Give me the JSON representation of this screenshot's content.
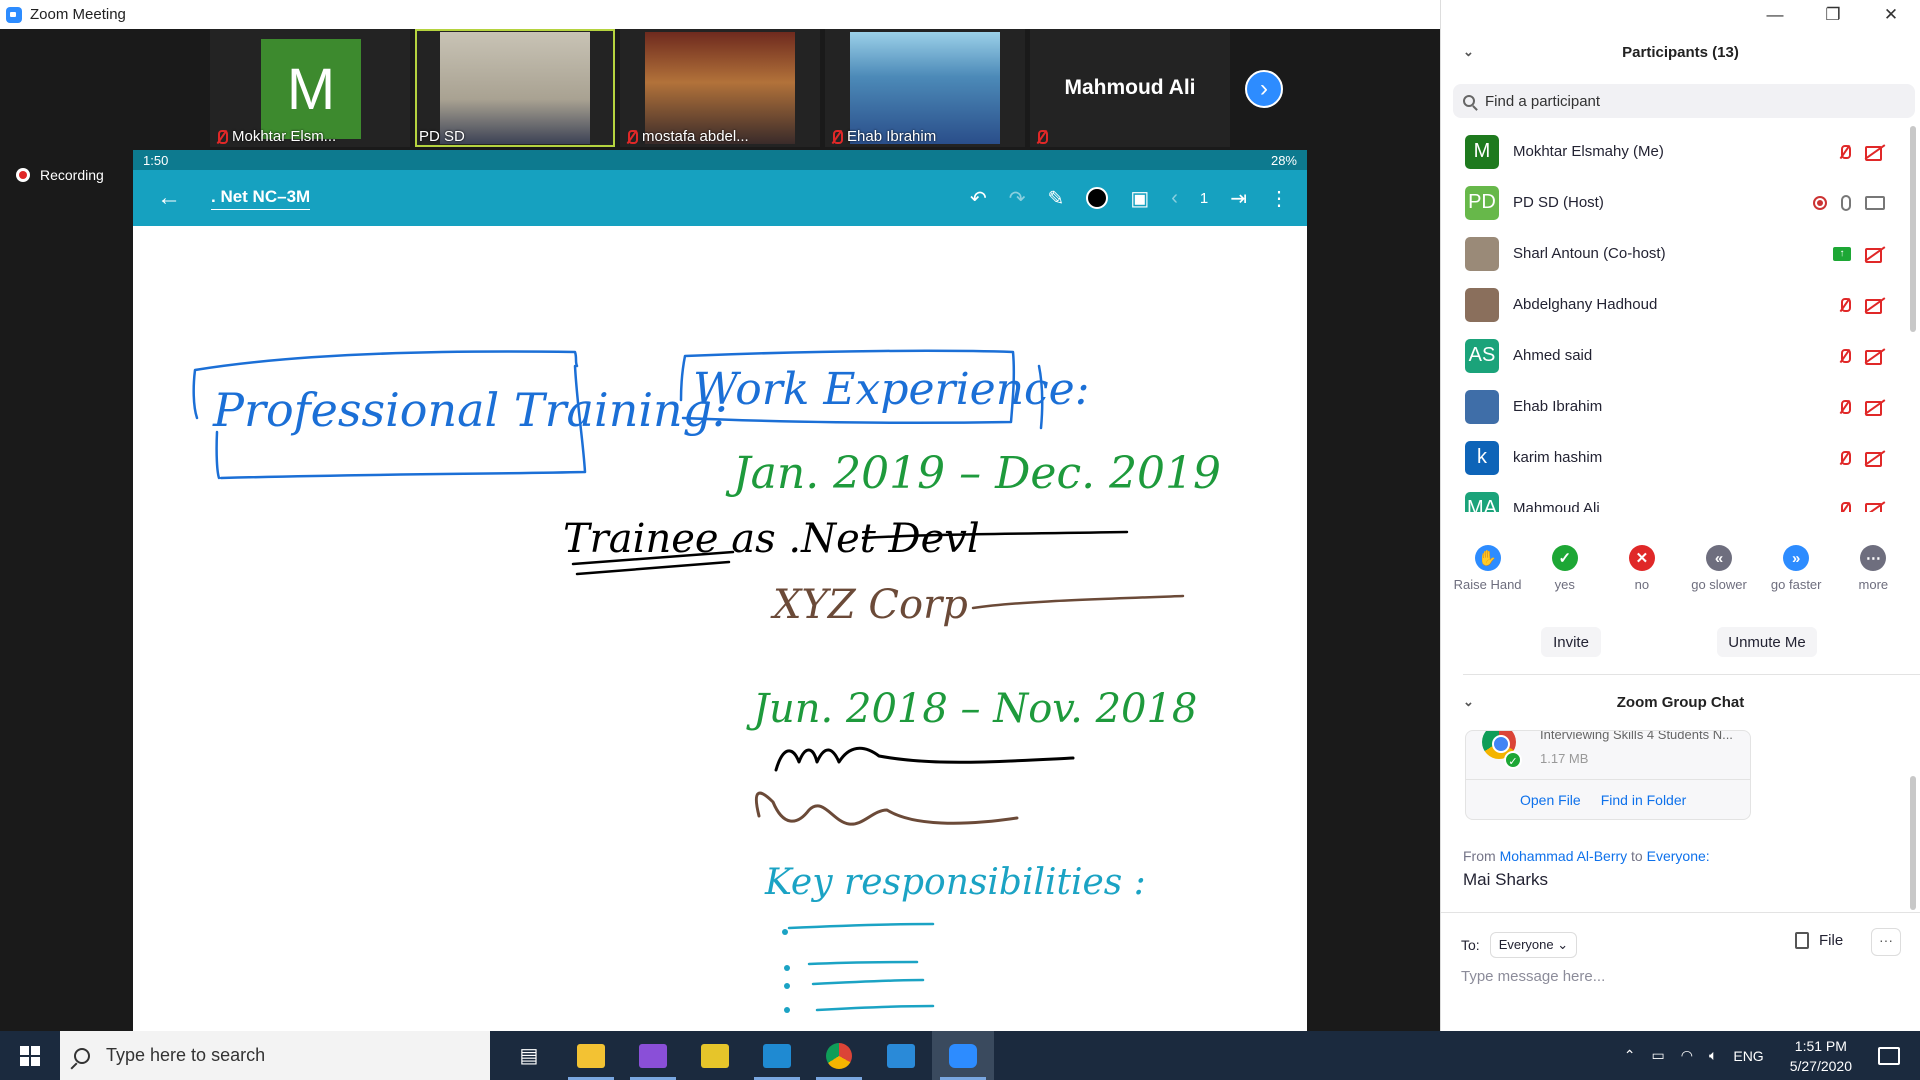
{
  "window": {
    "title": "Zoom Meeting"
  },
  "gallery": {
    "tiles": [
      {
        "name": "Mokhtar Elsm...",
        "avatar_letter": "M",
        "muted": true
      },
      {
        "name": "PD SD",
        "muted": false,
        "active": true
      },
      {
        "name": "mostafa abdel...",
        "muted": true
      },
      {
        "name": "Ehab Ibrahim",
        "muted": true
      },
      {
        "name": "",
        "big_name": "Mahmoud Ali",
        "muted": true
      }
    ]
  },
  "recording": {
    "label": "Recording"
  },
  "shared_screen": {
    "statusbar": {
      "time": "1:50",
      "battery": "28%"
    },
    "app_title": ". Net NC–3M",
    "page_number": "1",
    "handwriting": {
      "professional_training": "Professional Training:",
      "work_experience": "Work Experience:",
      "period1": "Jan. 2019 – Dec. 2019",
      "trainee": "Trainee as .Net Devl",
      "company": "XYZ Corp",
      "period2": "Jun. 2018 – Nov. 2018",
      "key_resp": "Key responsibilities :"
    }
  },
  "participants": {
    "title": "Participants (13)",
    "search_placeholder": "Find a participant",
    "list": [
      {
        "initials": "M",
        "name": "Mokhtar Elsmahy (Me)",
        "color": "#1e7a1e",
        "status": "muted"
      },
      {
        "initials": "PD",
        "name": "PD SD (Host)",
        "color": "#67b84a",
        "status": "host"
      },
      {
        "initials": "",
        "name": "Sharl Antoun (Co-host)",
        "color": "#9a8a78",
        "status": "sharing"
      },
      {
        "initials": "",
        "name": "Abdelghany Hadhoud",
        "color": "#8a6f5c",
        "status": "muted"
      },
      {
        "initials": "AS",
        "name": "Ahmed said",
        "color": "#1ba37a",
        "status": "muted"
      },
      {
        "initials": "",
        "name": "Ehab Ibrahim",
        "color": "#3f6ea8",
        "status": "muted"
      },
      {
        "initials": "k",
        "name": "karim hashim",
        "color": "#0e64b8",
        "status": "muted"
      },
      {
        "initials": "MA",
        "name": "Mahmoud Ali",
        "color": "#1ba37a",
        "status": "muted"
      }
    ]
  },
  "reactions": [
    {
      "label": "Raise Hand",
      "symbol": "✋",
      "color": "#2d8cff"
    },
    {
      "label": "yes",
      "symbol": "✓",
      "color": "#1da735"
    },
    {
      "label": "no",
      "symbol": "✕",
      "color": "#e02828"
    },
    {
      "label": "go slower",
      "symbol": "«",
      "color": "#6e6e7e"
    },
    {
      "label": "go faster",
      "symbol": "»",
      "color": "#2d8cff"
    },
    {
      "label": "more",
      "symbol": "⋯",
      "color": "#6e6e7e"
    }
  ],
  "actions": {
    "invite": "Invite",
    "unmute_me": "Unmute Me"
  },
  "chat": {
    "title": "Zoom Group Chat",
    "file_name": "Interviewing Skills 4 Students N...",
    "file_size": "1.17 MB",
    "open_file": "Open File",
    "find_in_folder": "Find in Folder",
    "from_label": "From",
    "sender": "Mohammad Al-Berry",
    "to_label": "to",
    "recipient": "Everyone:",
    "message": "Mai Sharks",
    "to_prefix": "To:",
    "to_value": "Everyone",
    "file_button": "File",
    "more_button": "···",
    "placeholder": "Type message here..."
  },
  "taskbar": {
    "search_placeholder": "Type here to search",
    "language": "ENG",
    "time": "1:51 PM",
    "date": "5/27/2020"
  },
  "colors": {
    "zoom_blue": "#2d8cff",
    "toolbar_teal": "#16a1c0",
    "muted_red": "#e02828"
  }
}
